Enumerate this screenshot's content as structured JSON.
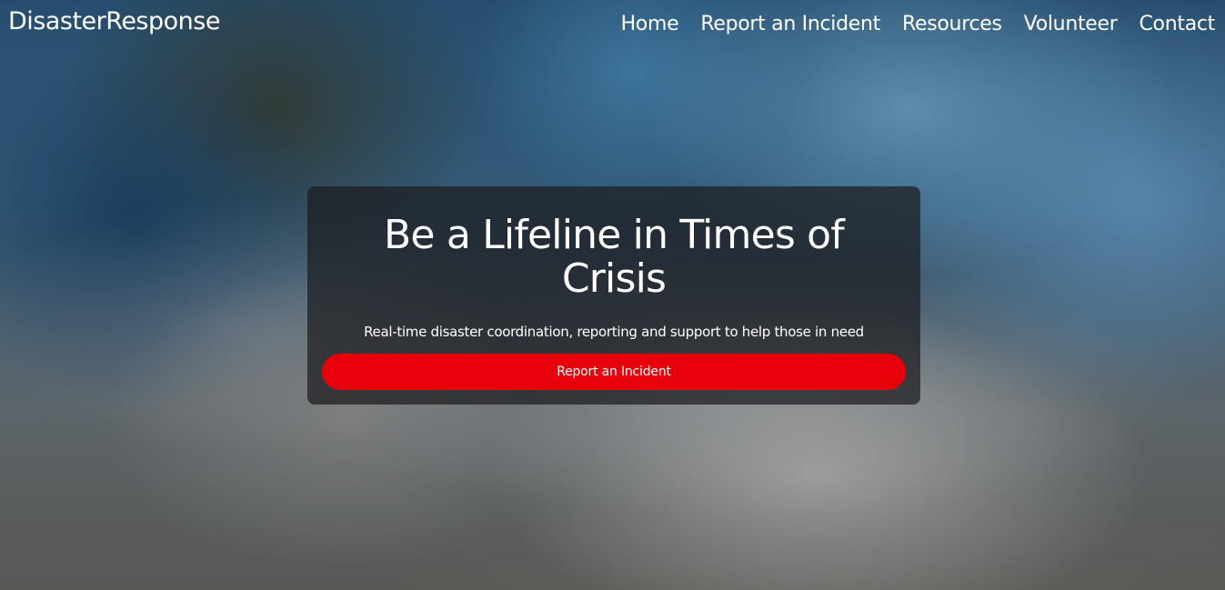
{
  "nav": {
    "brand": "DisasterResponse",
    "links": [
      {
        "label": "Home"
      },
      {
        "label": "Report an Incident"
      },
      {
        "label": "Resources"
      },
      {
        "label": "Volunteer"
      },
      {
        "label": "Contact"
      }
    ]
  },
  "hero": {
    "title": "Be a Lifeline in Times of Crisis",
    "subtitle": "Real-time disaster coordination, reporting and support to help those in need",
    "cta_label": "Report an Incident"
  },
  "colors": {
    "accent": "#e8000b",
    "card_bg": "#1c1c1e",
    "text": "#ffffff"
  }
}
